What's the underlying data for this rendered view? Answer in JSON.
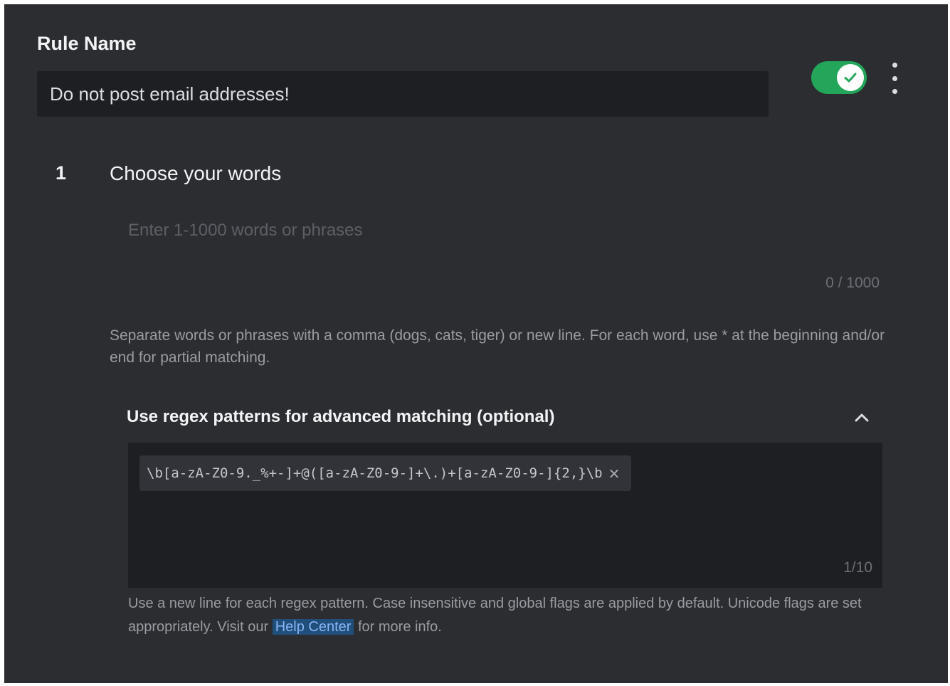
{
  "rule": {
    "name_label": "Rule Name",
    "name_value": "Do not post email addresses!",
    "enabled": true
  },
  "step1": {
    "number": "1",
    "title": "Choose your words",
    "keyword_placeholder": "Enter 1-1000 words or phrases",
    "keyword_count": "0 / 1000",
    "keyword_help": "Separate words or phrases with a comma (dogs, cats, tiger) or new line. For each word, use * at the beginning and/or end for partial matching."
  },
  "regex": {
    "title": "Use regex patterns for advanced matching (optional)",
    "patterns": [
      "\\b[a-zA-Z0-9._%+-]+@([a-zA-Z0-9-]+\\.)+[a-zA-Z0-9-]{2,}\\b"
    ],
    "remove_symbol": "×",
    "count": "1/10",
    "help_before": "Use a new line for each regex pattern. Case insensitive and global flags are applied by default. Unicode flags are set appropriately. Visit our",
    "help_link": "Help Center",
    "help_after": "for more info."
  },
  "colors": {
    "background": "#2b2d31",
    "input_background": "#1e1f22",
    "toggle_on": "#23a55a",
    "link_highlight": "#1f4f7a"
  },
  "icons": {
    "toggle": "check-icon",
    "more": "more-vertical-icon",
    "collapse": "chevron-up-icon",
    "remove": "close-icon"
  }
}
